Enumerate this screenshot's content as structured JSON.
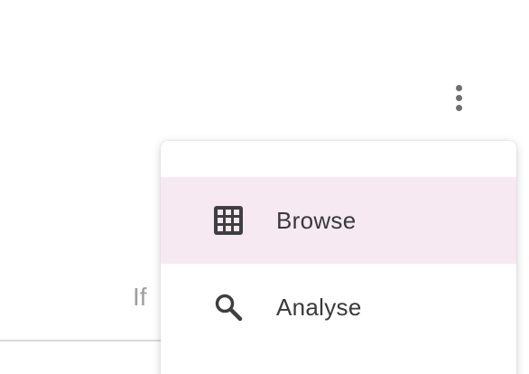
{
  "background": {
    "partial_text": "If"
  },
  "toolbar": {
    "more_icon": "more-vert-icon"
  },
  "menu": {
    "items": [
      {
        "label": "Browse",
        "icon": "grid-icon",
        "active": true
      },
      {
        "label": "Analyse",
        "icon": "search-icon",
        "active": false
      }
    ],
    "active_bg_color": "#f6e9f2"
  }
}
